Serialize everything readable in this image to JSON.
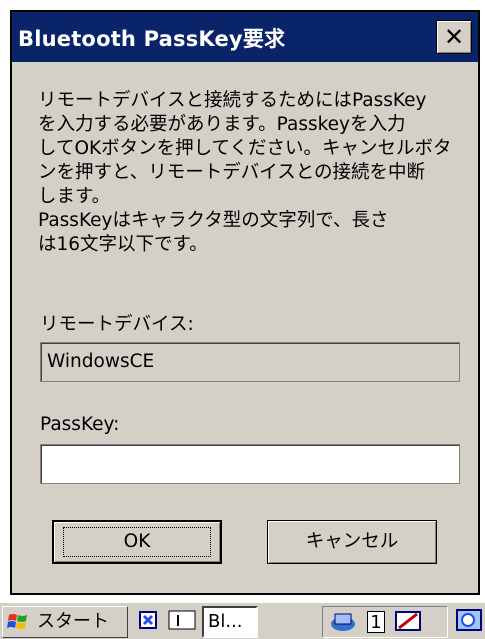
{
  "dialog": {
    "title": "Bluetooth PassKey要求",
    "close_glyph": "✕",
    "message_lines": [
      "リモートデバイスと接続するためにはPassKey",
      "を入力する必要があります。Passkeyを入力",
      "してOKボタンを押してください。キャンセルボタ",
      "ンを押すと、リモートデバイスとの接続を中断",
      "します。",
      "PassKeyはキャラクタ型の文字列で、長さ",
      "は16文字以下です。"
    ],
    "remote_device_label": "リモートデバイス:",
    "remote_device_value": "WindowsCE",
    "passkey_label": "PassKey:",
    "passkey_value": "",
    "ok_label": "OK",
    "cancel_label": "キャンセル"
  },
  "taskbar": {
    "start_label": "スタート",
    "task_label": "Bl...",
    "tray_number": "1",
    "icons": [
      "windows-flag-icon",
      "app-icon",
      "network-icon",
      "input-panel-icon",
      "pen-icon",
      "desktop-icon"
    ]
  },
  "colors": {
    "titlebar": "#0a246a",
    "face": "#d4d0c8",
    "text": "#000000"
  }
}
